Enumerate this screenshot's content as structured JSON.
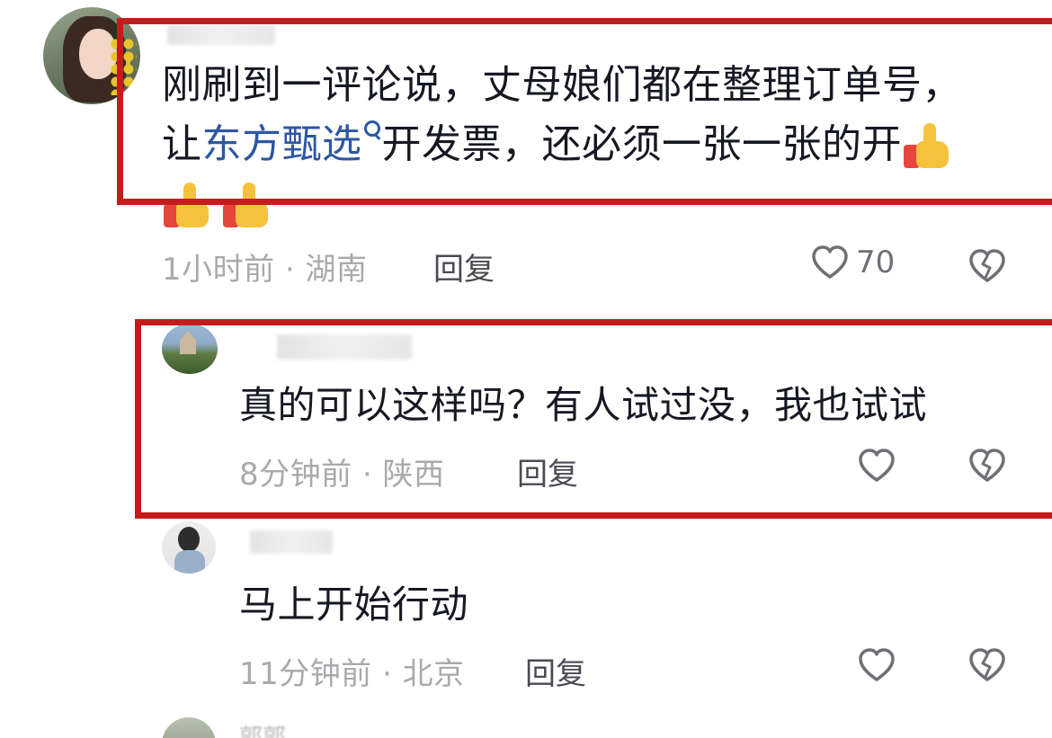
{
  "comments": [
    {
      "username_partial": "",
      "text_line1": "刚刷到一评论说，丈母娘们都在整理订单号，",
      "text_line2_prefix": "让",
      "link_text": "东方甄选",
      "text_line2_suffix": "开发票，还必须一张一张的开",
      "emoji_icon": "thumbs-up-icon",
      "time_location": "1小时前 · 湖南",
      "reply_label": "回复",
      "like_count": "70"
    },
    {
      "username_partial": "",
      "text": "真的可以这样吗？有人试过没，我也试试",
      "time_location": "8分钟前 · 陕西",
      "reply_label": "回复",
      "like_count": ""
    },
    {
      "username_partial": "",
      "text": "马上开始行动",
      "time_location": "11分钟前 · 北京",
      "reply_label": "回复",
      "like_count": ""
    },
    {
      "username_partial": "郭郭"
    }
  ],
  "colors": {
    "highlight_box": "#c41c1c",
    "link": "#2c57a3",
    "meta_text": "#a9aaae",
    "body_text": "#161823"
  }
}
